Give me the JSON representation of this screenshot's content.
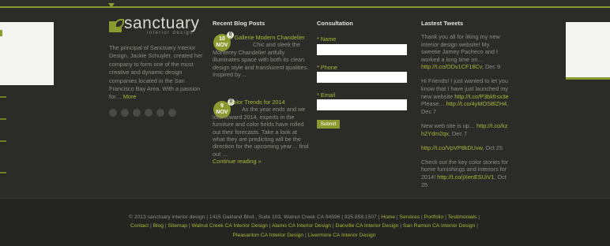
{
  "logo": {
    "name": "sanctuary",
    "tagline": "interior design"
  },
  "about": {
    "text": "The principal of Sanctuary Interior Design, Jackie Schuyler, created her company to form one of the most creative and dynamic design companies located in the San Francisco Bay Area. With a passion for… ",
    "more": "More"
  },
  "blog": {
    "heading": "Recent Blog Posts",
    "posts": [
      {
        "day": "10",
        "month": "NOV",
        "badge": "0",
        "title": "Z Gallerie Modern Chandelier",
        "excerpt": "Chic and sleek the Monterey Chandelier artfully illuminates space with both its clean design style and translucent qualities. Inspired by…"
      },
      {
        "day": "9",
        "month": "NOV",
        "badge": "0",
        "title": "Color Trends for 2014",
        "excerpt": "As the year ends and we look toward 2014, experts in the furniture and color fields have rolled out their forecasts. Take a look at what they are predicting will be the direction for the upcoming year… find out …",
        "more": "Continue reading »"
      }
    ]
  },
  "consultation": {
    "heading": "Consultation",
    "name_label": "* Name",
    "phone_label": "* Phone",
    "email_label": "* Email",
    "submit": "Submit"
  },
  "tweets": {
    "heading": "Lastest Tweets",
    "items": [
      {
        "text": "Thank you all for liking my new interior design website! My sweetie Jamey Pacheco and I worked a long time on… ",
        "link": "http://t.co/ODv1CF18Cv",
        "date": ", Dec 9"
      },
      {
        "text": "Hi Friends! I just wanted to let you know that I have just launched my new website ",
        "link": "http://t.co/P3bkfrsx3e",
        "mid": " Please… ",
        "link2": "http://t.co/4yMOSBlZH4",
        "date": ", Dec 7"
      },
      {
        "text": "New web site is up… ",
        "link": "http://t.co/kzh2Ydm2qx",
        "date": ", Dec 7"
      },
      {
        "text": "",
        "link": "http://t.co/VpVP8kDUvw",
        "date": ", Oct 25"
      },
      {
        "text": "Check out the key color stories for home furnishings and interiors for 2014! ",
        "link": "http://t.co/jXenESUiV1",
        "date": ", Oct 25"
      }
    ]
  },
  "footer": {
    "copyright": "© 2013 sanctuary interior design | 1415 Oakland Blvd., Suite 103, Walnut Creek CA 94596 | 925.858.1507 | ",
    "sep": " | ",
    "links_line1": [
      "Home",
      "Services",
      "Portfolio",
      "Testimonials"
    ],
    "links_line2": [
      "Contact",
      "Blog",
      "Sitemap",
      "Walnut Creek CA Interior Design",
      "Alamo CA Interior Design",
      "Danville CA Interior Design",
      "San Ramon CA Interior Design"
    ],
    "links_line3": [
      "Pleasanton CA Interior Design",
      "Livermore CA Interior Design"
    ]
  },
  "colors": {
    "accent": "#8a9a2e",
    "link": "#a9b83a",
    "background": "#2b2b27",
    "footer_bg": "#242421"
  },
  "icons": [
    "facebook-icon",
    "twitter-icon",
    "pinterest-icon",
    "google-plus-icon",
    "linkedin-icon",
    "houzz-icon"
  ]
}
